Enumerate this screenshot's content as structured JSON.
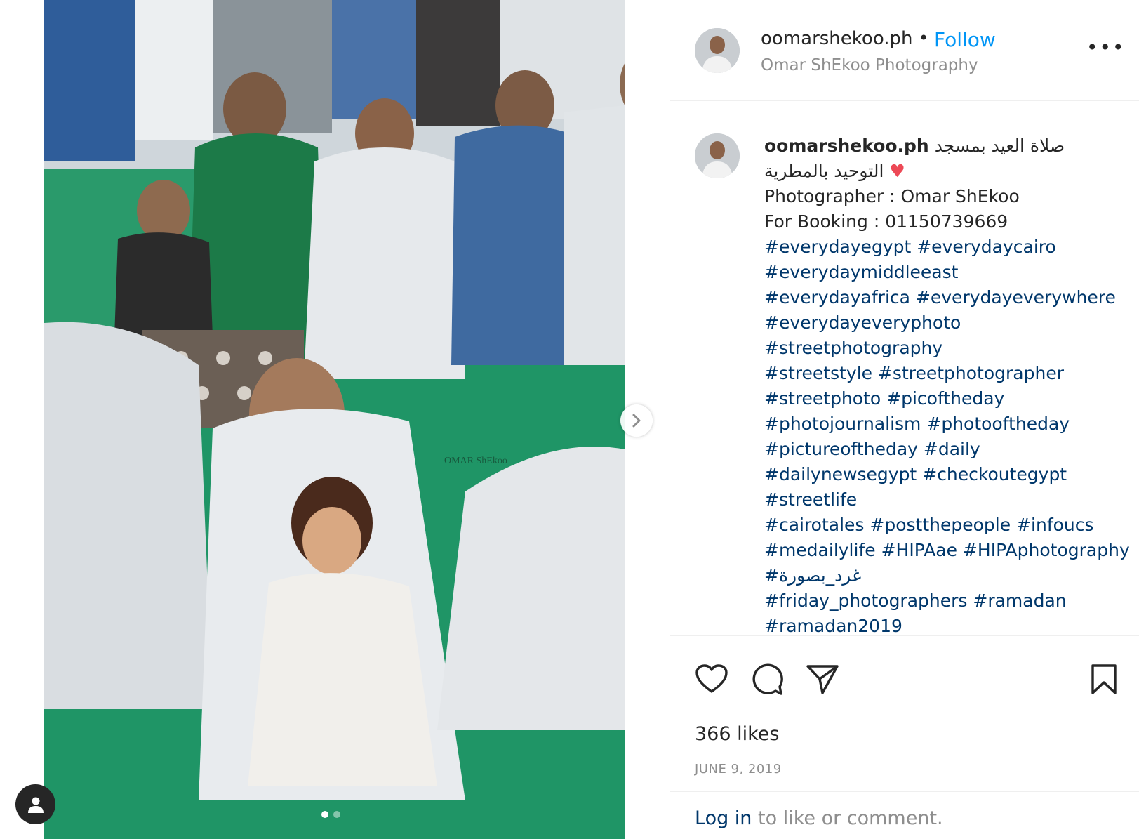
{
  "header": {
    "username": "oomarshekoo.ph",
    "separator": "•",
    "follow_label": "Follow",
    "subtitle": "Omar ShEkoo Photography",
    "more_icon": "more-options-icon",
    "more_label": "•••"
  },
  "caption": {
    "username": "oomarshekoo.ph",
    "arabic_line1": "صلاة العيد بمسجد",
    "arabic_line2": "التوحيد بالمطرية",
    "heart": "♥",
    "photographer": "Photographer : Omar ShEkoo",
    "booking": "For Booking : 01150739669",
    "tag_lines": [
      [
        "#everydayegypt",
        "#everydaycairo"
      ],
      [
        "#everydaymiddleeast"
      ],
      [
        "#everydayafrica",
        "#everydayeverywhere"
      ],
      [
        "#everydayeveryphoto"
      ],
      [
        "#streetphotography"
      ],
      [
        "#streetstyle",
        "#streetphotographer"
      ],
      [
        "#streetphoto",
        "#picoftheday"
      ],
      [
        "#photojournalism",
        "#photooftheday"
      ],
      [
        "#pictureoftheday",
        "#daily"
      ],
      [
        "#dailynewsegypt",
        "#checkoutegypt"
      ],
      [
        "#streetlife"
      ],
      [
        "#cairotales",
        "#postthepeople",
        "#infoucs"
      ],
      [
        "#medailylife",
        "#HIPAae",
        "#HIPAphotography"
      ],
      [
        "#غرد_بصورة"
      ],
      [
        "#friday_photographers",
        "#ramadan"
      ],
      [
        "#ramadan2019"
      ]
    ]
  },
  "actions": {
    "like_icon": "heart-icon",
    "comment_icon": "comment-icon",
    "share_icon": "share-icon",
    "save_icon": "bookmark-icon"
  },
  "likes_text": "366 likes",
  "date": "JUNE 9, 2019",
  "login": {
    "link": "Log in",
    "rest": " to like or comment."
  },
  "photo": {
    "carousel_total": 2,
    "carousel_active": 1,
    "watermark": "OMAR ShEkoo"
  },
  "colors": {
    "accent": "#0095f6",
    "hashtag": "#00376b",
    "muted": "#8e8e8e",
    "heart": "#ed4956",
    "carpet": "#2a9a6b"
  }
}
